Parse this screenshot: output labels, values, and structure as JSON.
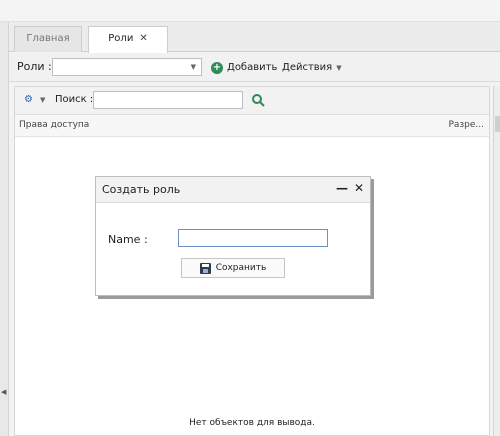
{
  "tabs": [
    {
      "label": "Главная"
    },
    {
      "label": "Роли",
      "close": "✕"
    }
  ],
  "toolbar": {
    "roles_label": "Роли :",
    "roles_value": "",
    "add_label": "Добавить",
    "actions_label": "Действия"
  },
  "panel": {
    "search_label": "Поиск :",
    "search_value": "",
    "columns": [
      "Права доступа",
      "Разре..."
    ],
    "empty_message": "Нет объектов для вывода."
  },
  "dialog": {
    "title": "Создать роль",
    "name_label": "Name :",
    "name_value": "",
    "save_label": "Сохранить"
  },
  "colors": {
    "accent_green": "#2f8a57",
    "accent_blue": "#2a62a8",
    "input_focus_border": "#6b8fc0"
  }
}
